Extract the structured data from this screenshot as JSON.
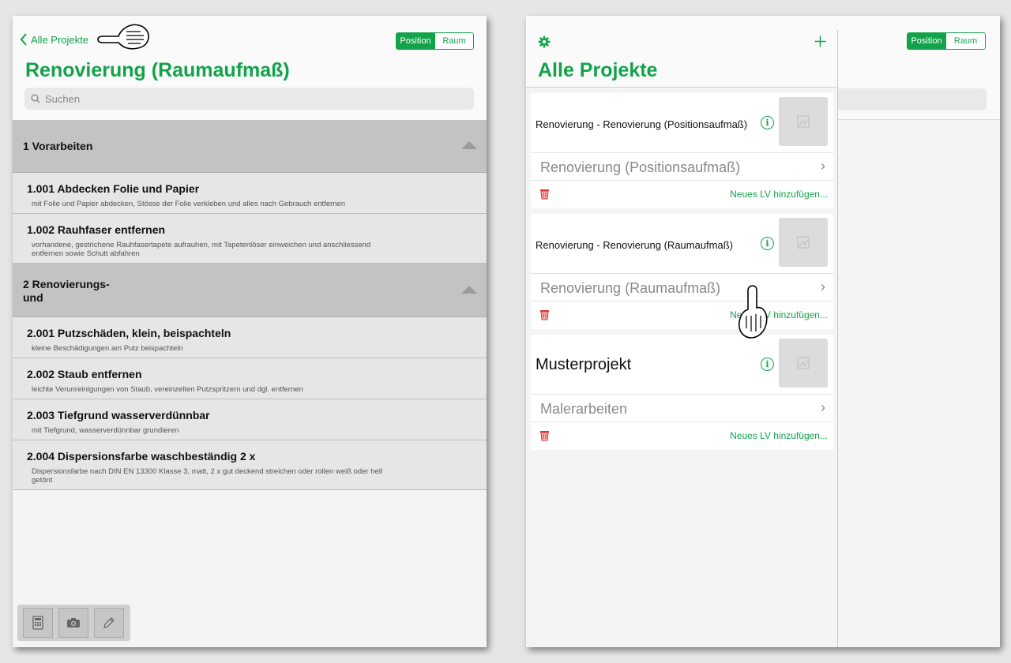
{
  "left": {
    "back_label": "Alle Projekte",
    "segment": {
      "position": "Position",
      "raum": "Raum"
    },
    "title": "Renovierung (Raumaufmaß)",
    "search_placeholder": "Suchen",
    "sections": [
      {
        "title": "1 Vorarbeiten"
      },
      {
        "title_line1": "2 Renovierungs-",
        "title_line2": "und"
      }
    ],
    "items": [
      {
        "title": "1.001 Abdecken Folie und Papier",
        "desc": "mit Folie und Papier abdecken, Stösse der Folie verkleben und alles nach Gebrauch entfernen"
      },
      {
        "title": "1.002 Rauhfaser entfernen",
        "desc": "vorhandene, gestrichene Rauhfasertapete aufrauhen, mit Tapetenlöser einweichen und anschliessend entfernen sowie Schutt abfahren"
      },
      {
        "title": "2.001 Putzschäden, klein, beispachteln",
        "desc": "kleine Beschädigungen am Putz beispachteln"
      },
      {
        "title": "2.002 Staub entfernen",
        "desc": "leichte Verunreinigungen von Staub, vereinzelten Putzspritzern und dgl. entfernen"
      },
      {
        "title": "2.003 Tiefgrund wasserverdünnbar",
        "desc": "mit Tiefgrund, wasserverdünnbar grundieren"
      },
      {
        "title": "2.004 Dispersionsfarbe waschbeständig 2 x",
        "desc": "Dispersionsfarbe nach DIN EN 13300 Klasse 3, matt, 2 x gut deckend streichen oder rollen weiß oder hell getönt"
      }
    ]
  },
  "right": {
    "title": "Alle Projekte",
    "segment": {
      "position": "Position",
      "raum": "Raum"
    },
    "projects": [
      {
        "name": "Renovierung - Renovierung (Positionsaufmaß)",
        "lv": "Renovierung (Positionsaufmaß)",
        "add": "Neues LV hinzufügen..."
      },
      {
        "name": "Renovierung - Renovierung (Raumaufmaß)",
        "lv": "Renovierung (Raumaufmaß)",
        "add": "Neues LV hinzufügen..."
      },
      {
        "name": "Musterprojekt",
        "lv": "Malerarbeiten",
        "add": "Neues LV hinzufügen..."
      }
    ],
    "info_glyph": "i",
    "chevron_glyph": "›"
  },
  "colors": {
    "accent": "#12a34a",
    "section_bg": "#c3c3c3",
    "trash": "#e0332f"
  }
}
